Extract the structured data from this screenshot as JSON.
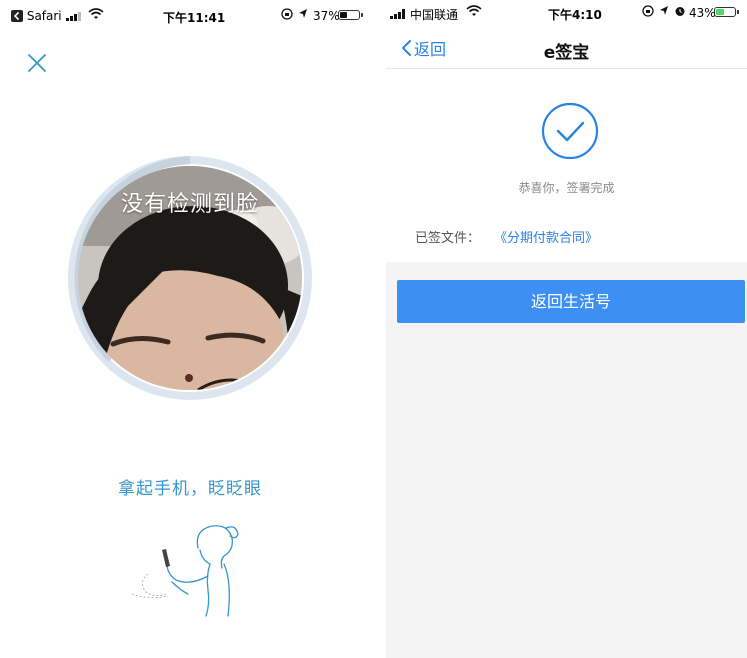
{
  "left": {
    "status_bar": {
      "back_app": "Safari",
      "time": "下午11:41",
      "battery": "37%",
      "battery_level": 0.37
    },
    "face_status": "没有检测到脸",
    "instruction": "拿起手机，眨眨眼"
  },
  "right": {
    "status_bar": {
      "carrier": "中国联通",
      "time": "下午4:10",
      "battery": "43%",
      "battery_level": 0.43
    },
    "nav": {
      "back_label": "返回",
      "title": "e签宝"
    },
    "success_message": "恭喜你，签署完成",
    "signed_file_label": "已签文件：",
    "signed_file_name": "《分期付款合同》",
    "return_button_label": "返回生活号"
  },
  "colors": {
    "accent_blue": "#3596cc",
    "link_blue": "#2a82e4",
    "button_blue": "#3d8ff3",
    "battery_green": "#4cd964"
  },
  "icons": [
    "close-icon",
    "camera-ring",
    "person-phone-illustration",
    "back-chevron-icon",
    "check-circle-icon",
    "wifi-icon",
    "signal-icon",
    "location-icon",
    "alarm-icon",
    "rotation-lock-icon"
  ]
}
